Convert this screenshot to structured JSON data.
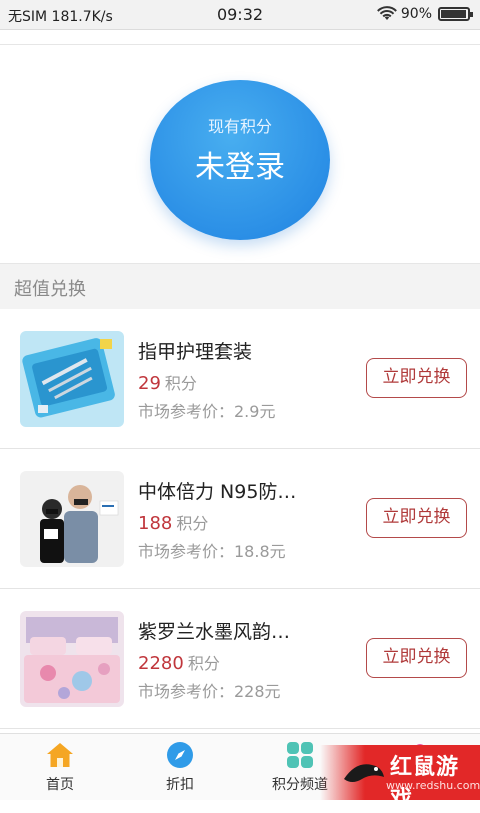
{
  "status_bar": {
    "carrier": "无SIM 181.7K/s",
    "time": "09:32",
    "battery": "90%",
    "battery_level": 0.9
  },
  "points_card": {
    "label": "现有积分",
    "value": "未登录",
    "color": "#2b8fe6"
  },
  "section": {
    "title": "超值兑换"
  },
  "products": [
    {
      "name": "指甲护理套装",
      "points": "29",
      "points_unit": "积分",
      "market_price": "市场参考价：2.9元",
      "action": "立即兑换"
    },
    {
      "name": "中体倍力 N95防…",
      "points": "188",
      "points_unit": "积分",
      "market_price": "市场参考价：18.8元",
      "action": "立即兑换"
    },
    {
      "name": "紫罗兰水墨风韵…",
      "points": "2280",
      "points_unit": "积分",
      "market_price": "市场参考价：228元",
      "action": "立即兑换"
    }
  ],
  "tabs": [
    {
      "label": "首页",
      "icon": "home-icon"
    },
    {
      "label": "折扣",
      "icon": "compass-icon"
    },
    {
      "label": "积分频道",
      "icon": "grid-icon"
    },
    {
      "label": "",
      "icon": "user-icon"
    }
  ],
  "watermark": {
    "title": "红鼠游戏",
    "url": "www.redshu.com"
  },
  "colors": {
    "accent_red": "#c0363c",
    "accent_blue": "#2b8fe6",
    "watermark_red": "#e22828"
  }
}
